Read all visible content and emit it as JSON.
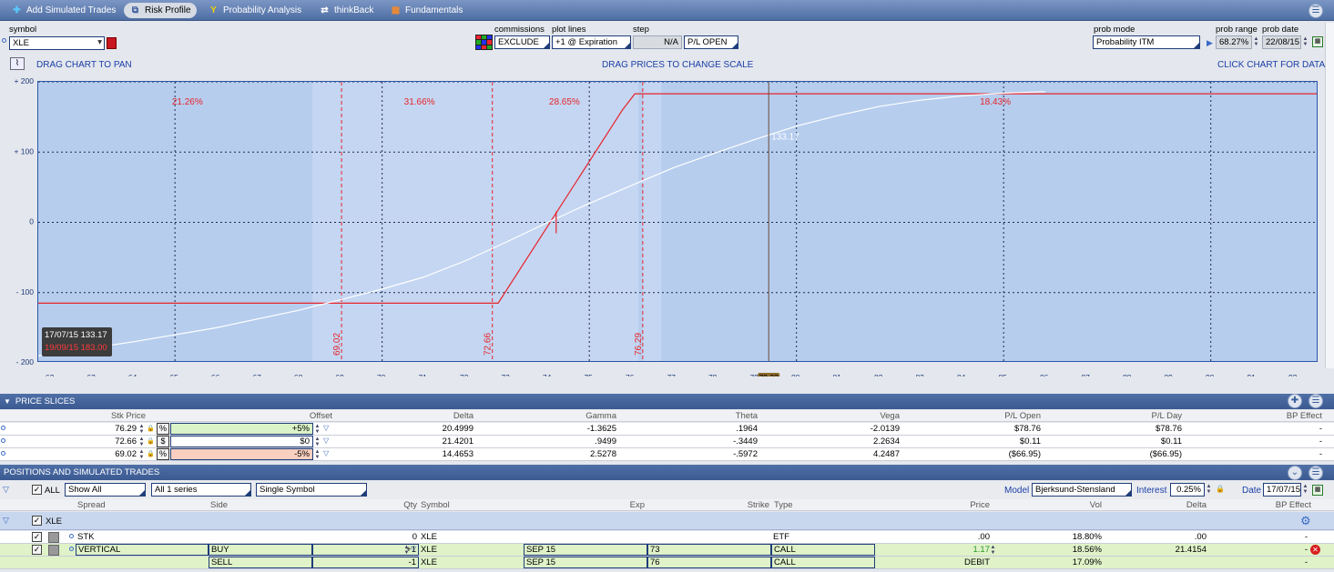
{
  "toolbar": {
    "tabs": [
      {
        "label": "Add Simulated Trades"
      },
      {
        "label": "Risk Profile"
      },
      {
        "label": "Probability Analysis"
      },
      {
        "label": "thinkBack"
      },
      {
        "label": "Fundamentals"
      }
    ]
  },
  "controls": {
    "symbol_label": "symbol",
    "symbol_value": "XLE",
    "commissions_label": "commissions",
    "commissions_value": "EXCLUDE",
    "plot_lines_label": "plot lines",
    "plot_lines_value": "+1 @ Expiration",
    "step_label": "step",
    "step_value": "N/A",
    "step_mode": "P/L OPEN",
    "prob_mode_label": "prob mode",
    "prob_mode_value": "Probability ITM",
    "prob_range_label": "prob range",
    "prob_range_value": "68.27%",
    "prob_date_label": "prob date",
    "prob_date_value": "22/08/15",
    "drag_pan": "DRAG CHART TO PAN",
    "drag_scale": "DRAG PRICES TO CHANGE SCALE",
    "click_data": "CLICK CHART FOR DATA"
  },
  "chart_data": {
    "type": "line",
    "xlim": [
      61.7,
      92.6
    ],
    "ylim": [
      -200,
      200
    ],
    "x_ticks": [
      "62",
      "63",
      "64",
      "65",
      "66",
      "67",
      "68",
      "69",
      "70",
      "71",
      "72",
      "73",
      "74",
      "75",
      "76",
      "77",
      "78",
      "79",
      "80",
      "81",
      "82",
      "83",
      "84",
      "85",
      "86",
      "87",
      "88",
      "89",
      "90",
      "91",
      "92"
    ],
    "y_ticks": [
      "+ 200",
      "+ 100",
      "0",
      "- 100",
      "- 200"
    ],
    "y_tick_values": [
      200,
      100,
      0,
      -100,
      -200
    ],
    "series": [
      {
        "color": "#e8242a",
        "x": [
          61.7,
          72.8,
          75.8,
          76.1,
          92.6
        ],
        "y": [
          -115,
          -115,
          160,
          183,
          183
        ]
      },
      {
        "color": "#ffffff",
        "x": [
          61.7,
          64,
          66,
          68,
          70,
          71,
          72,
          73,
          74,
          75,
          76,
          77,
          78,
          79,
          80,
          81,
          82,
          83,
          84,
          85,
          86
        ],
        "y": [
          -190,
          -170,
          -150,
          -125,
          -95,
          -78,
          -55,
          -28,
          0,
          27,
          52,
          77,
          98,
          118,
          137,
          152,
          165,
          174,
          180,
          184,
          186
        ]
      }
    ],
    "strikes": [
      {
        "x": 69.02,
        "label": "69.02"
      },
      {
        "x": 72.66,
        "label": "72.66"
      },
      {
        "x": 76.29,
        "label": "76.29"
      }
    ],
    "probabilities": [
      {
        "x": 65.3,
        "label": "21.26%"
      },
      {
        "x": 70.9,
        "label": "31.66%"
      },
      {
        "x": 74.4,
        "label": "28.65%"
      },
      {
        "x": 84.8,
        "label": "18.43%"
      }
    ],
    "cursor_x": 79.33,
    "cursor_label": "79.33",
    "point_label": "133.17",
    "info_box": {
      "line1": "17/07/15  133.17",
      "line2": "19/09/15  183.00"
    }
  },
  "price_slices": {
    "title": "PRICE SLICES",
    "columns": [
      "Stk Price",
      "Offset",
      "Delta",
      "Gamma",
      "Theta",
      "Vega",
      "P/L Open",
      "P/L Day",
      "BP Effect"
    ],
    "rows": [
      {
        "stk": "76.29",
        "type": "%",
        "offset": "+5%",
        "delta": "20.4999",
        "gamma": "-1.3625",
        "theta": ".1964",
        "vega": "-2.0139",
        "plopen": "$78.76",
        "plday": "$78.76",
        "bp": "-",
        "bg": "#dbf3c8"
      },
      {
        "stk": "72.66",
        "type": "$",
        "offset": "$0",
        "delta": "21.4201",
        "gamma": ".9499",
        "theta": "-.3449",
        "vega": "2.2634",
        "plopen": "$0.11",
        "plday": "$0.11",
        "bp": "-",
        "bg": "#ffffff"
      },
      {
        "stk": "69.02",
        "type": "%",
        "offset": "-5%",
        "delta": "14.4653",
        "gamma": "2.5278",
        "theta": "-.5972",
        "vega": "4.2487",
        "plopen": "($66.95)",
        "plday": "($66.95)",
        "bp": "-",
        "bg": "#f9cfbf"
      }
    ]
  },
  "positions": {
    "title": "POSITIONS AND SIMULATED TRADES",
    "all_label": "ALL",
    "show_value": "Show All",
    "series_value": "All 1 series",
    "symbol_filter": "Single Symbol",
    "model_label": "Model",
    "model_value": "Bjerksund-Stensland",
    "interest_label": "Interest",
    "interest_value": "0.25%",
    "date_label": "Date",
    "date_value": "17/07/15",
    "columns": [
      "Spread",
      "Side",
      "Qty",
      "Symbol",
      "Exp",
      "Strike",
      "Type",
      "Price",
      "Vol",
      "Delta",
      "BP Effect"
    ],
    "group": "XLE",
    "rows": [
      {
        "spread": "STK",
        "side": "",
        "qty": "0",
        "symbol": "XLE",
        "exp": "",
        "strike": "",
        "type": "ETF",
        "price": ".00",
        "vol": "18.80%",
        "delta": ".00",
        "bp": "-"
      },
      {
        "spread": "VERTICAL",
        "side": "BUY",
        "qty": "+1",
        "symbol": "XLE",
        "exp": "SEP 15",
        "strike": "73",
        "type": "CALL",
        "price": "1.17",
        "vol": "18.56%",
        "delta": "21.4154",
        "bp": "-"
      },
      {
        "spread": "",
        "side": "SELL",
        "qty": "-1",
        "symbol": "XLE",
        "exp": "SEP 15",
        "strike": "76",
        "type": "CALL",
        "price": "DEBIT",
        "vol": "17.09%",
        "delta": "",
        "bp": "-"
      }
    ]
  }
}
